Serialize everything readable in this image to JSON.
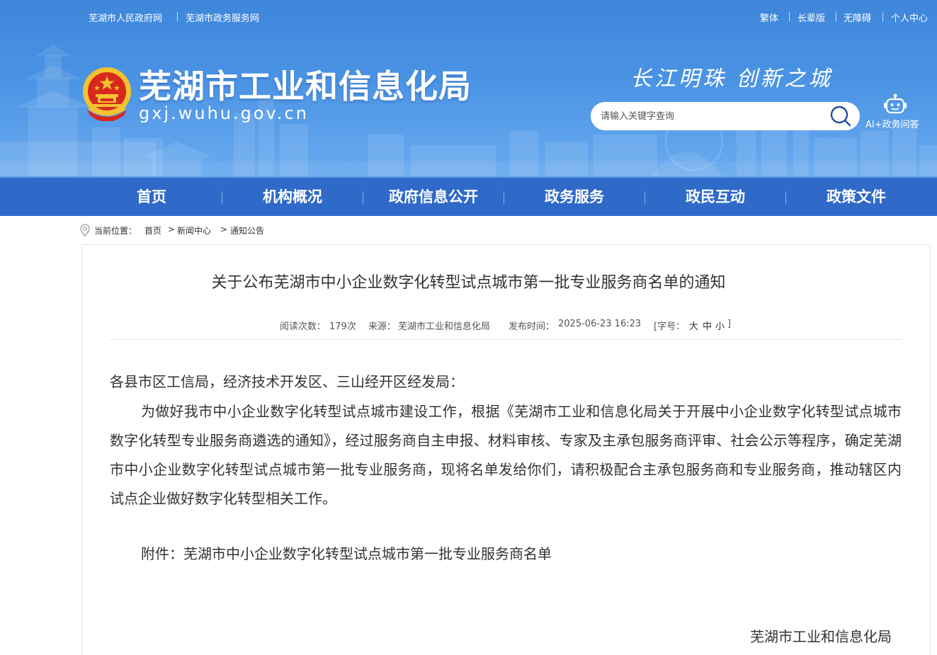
{
  "top_links_left": [
    "芜湖市人民政府网",
    "芜湖市政务服务网"
  ],
  "top_links_right": [
    "繁体",
    "长辈版",
    "无障碍",
    "个人中心"
  ],
  "site": {
    "title": "芜湖市工业和信息化局",
    "domain": "gxj.wuhu.gov.cn",
    "slogan": "长江明珠 创新之城"
  },
  "search": {
    "placeholder": "请输入关键字查询",
    "value": ""
  },
  "ai_assistant": {
    "label": "AI+政务问答",
    "icon": "robot-icon"
  },
  "nav": {
    "items": [
      "首页",
      "机构概况",
      "政府信息公开",
      "政务服务",
      "政民互动",
      "政策文件"
    ]
  },
  "breadcrumb": {
    "prefix": "当前位置：",
    "items": [
      "首页",
      "新闻中心",
      "通知公告"
    ],
    "separator": ">"
  },
  "article": {
    "title": "关于公布芜湖市中小企业数字化转型试点城市第一批专业服务商名单的通知",
    "meta": {
      "reads_label": "阅读次数：",
      "reads_value": "179次",
      "source_label": "来源：",
      "source_value": "芜湖市工业和信息化局",
      "time_label": "发布时间：",
      "time_value": "2025-06-23 16:23",
      "font_label": "[字号：",
      "font_large": "大",
      "font_medium": "中",
      "font_small": "小",
      "font_close": "]"
    },
    "salutation": "各县市区工信局，经济技术开发区、三山经开区经发局：",
    "body": "为做好我市中小企业数字化转型试点城市建设工作，根据《芜湖市工业和信息化局关于开展中小企业数字化转型试点城市数字化转型专业服务商遴选的通知》，经过服务商自主申报、材料审核、专家及主承包服务商评审、社会公示等程序，确定芜湖市中小企业数字化转型试点城市第一批专业服务商，现将名单发给你们，请积极配合主承包服务商和专业服务商，推动辖区内试点企业做好数字化转型相关工作。",
    "attachment": "附件：芜湖市中小企业数字化转型试点城市第一批专业服务商名单",
    "signature": "芜湖市工业和信息化局"
  },
  "colors": {
    "header_blue": "#3e86db",
    "nav_blue": "#2f6ac9",
    "text": "#333333"
  }
}
